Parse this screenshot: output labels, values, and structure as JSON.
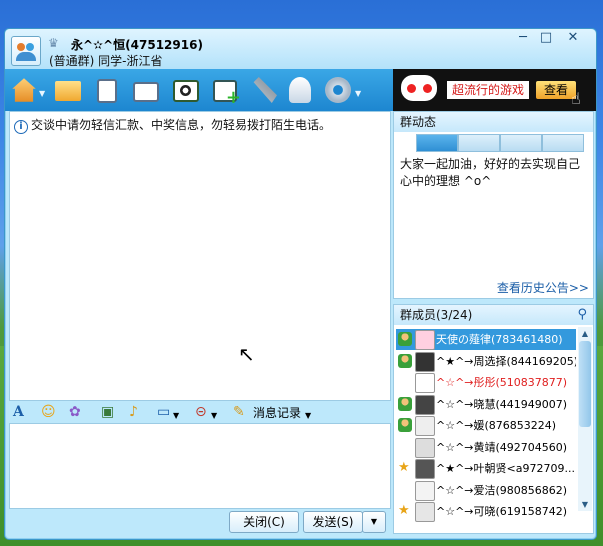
{
  "window": {
    "group_name": "永^✫^恒(47512916)",
    "group_sub": "(普通群) 同学-浙江省"
  },
  "ad": {
    "game_label": "超流行的游戏",
    "view_label": "查看"
  },
  "chat": {
    "notice": "交谈中请勿轻信汇款、中奖信息，勿轻易拨打陌生电话。"
  },
  "format_bar": {
    "history_label": "消息记录"
  },
  "actions": {
    "close_label": "关闭(C)",
    "send_label": "发送(S)"
  },
  "group_news": {
    "title": "群动态",
    "text": "大家一起加油，好好的去实现自己心中的理想 ^o^",
    "history_link": "查看历史公告>>"
  },
  "members": {
    "title": "群成员(3/24)",
    "list": [
      {
        "name": "天使の薤律(783461480)",
        "color": "#ffffff",
        "selected": true
      },
      {
        "name": "^★^→周选择(844169205)",
        "color": "#000000"
      },
      {
        "name": "^☆^→彤彤(510837877)",
        "color": "#e02020"
      },
      {
        "name": "^☆^→晓慧(441949007)",
        "color": "#000000"
      },
      {
        "name": "^☆^→媛(876853224)",
        "color": "#000000"
      },
      {
        "name": "^☆^→黄靖(492704560)",
        "color": "#000000"
      },
      {
        "name": "^★^→叶朝贤<a972709...",
        "color": "#000000"
      },
      {
        "name": "^☆^→爱洁(980856862)",
        "color": "#000000"
      },
      {
        "name": "^☆^→可晓(619158742)",
        "color": "#000000"
      }
    ]
  }
}
